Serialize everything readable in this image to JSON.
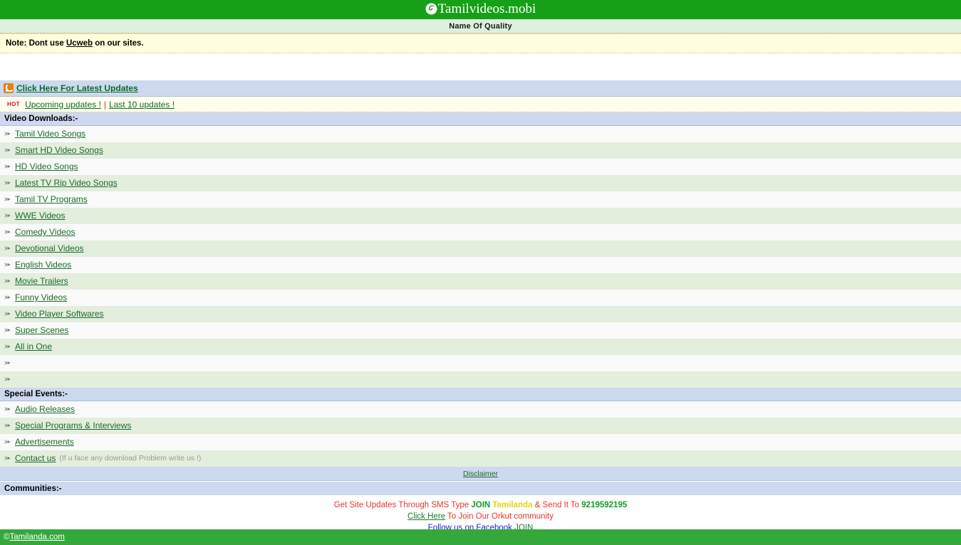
{
  "header": {
    "logo_icon": "swirl-logo-icon",
    "site_title": "Tamilvideos.mobi",
    "subtitle": "Name Of Quality"
  },
  "note": {
    "prefix": "Note: Dont use ",
    "link": "Ucweb",
    "suffix": " on our sites."
  },
  "rss": {
    "icon": "rss-feed-icon",
    "link_label": "Click Here For Latest Updates"
  },
  "hot": {
    "badge": "HOT",
    "link1": "Upcoming updates !",
    "separator": "|",
    "link2": "Last 10 updates !"
  },
  "sections": [
    {
      "title": "Video Downloads:-",
      "items": [
        {
          "label": "Tamil Video Songs"
        },
        {
          "label": "Smart HD Video Songs"
        },
        {
          "label": "HD Video Songs"
        },
        {
          "label": "Latest TV Rip Video Songs"
        },
        {
          "label": "Tamil TV Programs"
        },
        {
          "label": "WWE Videos"
        },
        {
          "label": "Comedy Videos"
        },
        {
          "label": "Devotional Videos"
        },
        {
          "label": "English Videos"
        },
        {
          "label": "Movie Trailers"
        },
        {
          "label": "Funny Videos"
        },
        {
          "label": "Video Player Softwares"
        },
        {
          "label": "Super Scenes"
        },
        {
          "label": "All in One"
        },
        {
          "label": ""
        },
        {
          "label": ""
        }
      ]
    },
    {
      "title": "Special Events:-",
      "items": [
        {
          "label": "Audio Releases"
        },
        {
          "label": "Special Programs & Interviews"
        },
        {
          "label": "Advertisements"
        },
        {
          "label": "Contact us",
          "note": "(If u face any download Problem write us !)"
        }
      ]
    }
  ],
  "disclaimer": {
    "label": "Disclaimer"
  },
  "communities": {
    "title": "Communities:-"
  },
  "promo": {
    "sms_part1": "Get Site Updates Through SMS Type ",
    "sms_join": "JOIN",
    "sms_keyword": "Tamilanda",
    "sms_part2": " & Send It To ",
    "sms_number": "9219592195",
    "orkut_link": "Click Here",
    "orkut_text": " To Join Our Orkut community",
    "facebook_text": "Follow us on Facebook ",
    "facebook_link": "JOIN"
  },
  "footer": {
    "copyright_symbol": "© ",
    "link": "Tamilanda.com"
  },
  "colors": {
    "brand_green": "#16a017",
    "footer_green": "#34a83a",
    "section_blue": "#ccd9ef",
    "row_green": "#e3eedd",
    "row_white": "#fafafa",
    "note_yellow": "#ffffdd",
    "link_green": "#1b6b2b",
    "accent_red": "#e8342a",
    "accent_yellow": "#e8d20c",
    "accent_blue": "#2222cc"
  }
}
